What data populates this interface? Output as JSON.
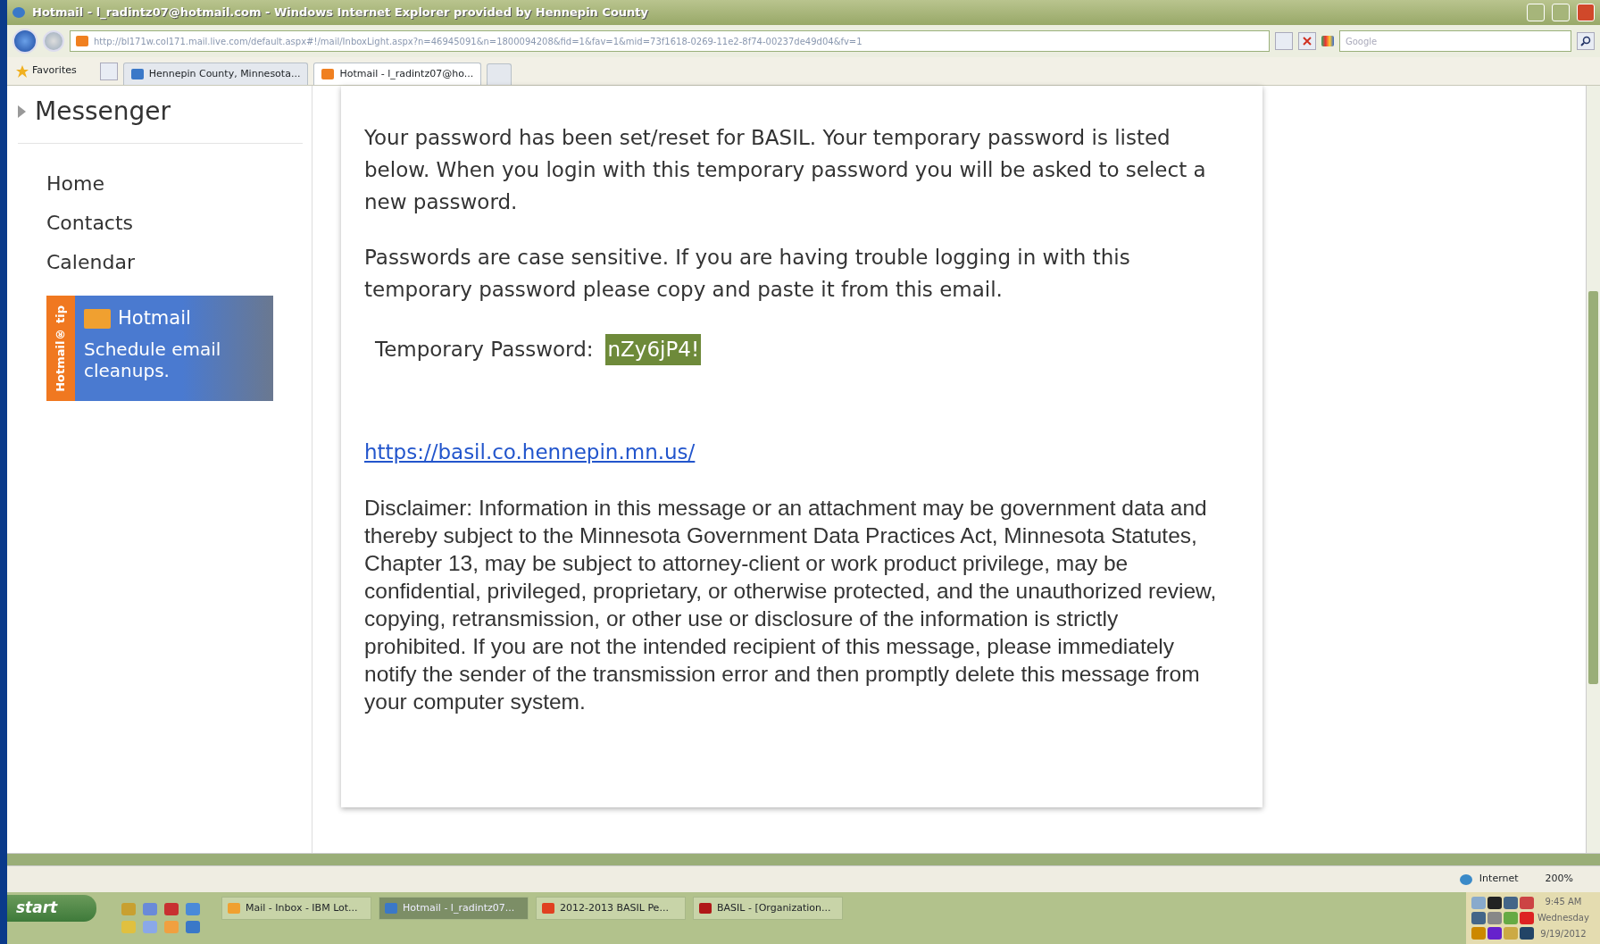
{
  "window": {
    "title": "Hotmail - l_radintz07@hotmail.com - Windows Internet Explorer provided by Hennepin County"
  },
  "address_bar": {
    "url": "http://bl171w.col171.mail.live.com/default.aspx#!/mail/InboxLight.aspx?n=46945091&n=1800094208&fid=1&fav=1&mid=73f1618-0269-11e2-8f74-00237de49d04&fv=1",
    "search_placeholder": "Google"
  },
  "favorites_label": "Favorites",
  "tabs": [
    {
      "label": "Hennepin County, Minnesota...",
      "selected": false
    },
    {
      "label": "Hotmail - l_radintz07@ho...",
      "selected": true
    }
  ],
  "sidebar": {
    "heading": "Messenger",
    "items": [
      "Home",
      "Contacts",
      "Calendar"
    ],
    "ad": {
      "side_label": "Hotmail® tip",
      "brand": "Hotmail",
      "text": "Schedule email cleanups."
    }
  },
  "message": {
    "paragraphs": [
      "Your password has been set/reset for BASIL. Your temporary password is listed below. When you login with this temporary password you will be asked to select a new password.",
      "Passwords are case sensitive. If you are having trouble logging in with this temporary password please copy and paste it from this email."
    ],
    "password_label": "Temporary Password:",
    "password": "nZy6jP4!",
    "password_selected": true,
    "link": "https://basil.co.hennepin.mn.us/",
    "disclaimer": "Disclaimer: Information in this message or an attachment may be government data and thereby subject to the Minnesota Government Data Practices Act, Minnesota Statutes, Chapter 13, may be subject to attorney-client or work product privilege, may be confidential, privileged, proprietary, or otherwise protected, and the unauthorized review, copying, retransmission, or other use or disclosure of the information is strictly prohibited. If you are not the intended recipient of this message, please immediately notify the sender of the transmission error and then promptly delete this message from your computer system."
  },
  "status_bar": {
    "zone": "Internet",
    "zoom": "200%"
  },
  "taskbar": {
    "start": "start",
    "buttons": [
      {
        "label": "Mail - Inbox - IBM Lot...",
        "selected": false,
        "color": "#f0a030"
      },
      {
        "label": "Hotmail - l_radintz07...",
        "selected": true,
        "color": "#3a78c8"
      },
      {
        "label": "2012-2013 BASIL Pe...",
        "selected": false,
        "color": "#e04020"
      },
      {
        "label": "BASIL - [Organization...",
        "selected": false,
        "color": "#b01818"
      }
    ],
    "clock": {
      "time": "9:45 AM",
      "day": "Wednesday",
      "date": "9/19/2012"
    }
  }
}
